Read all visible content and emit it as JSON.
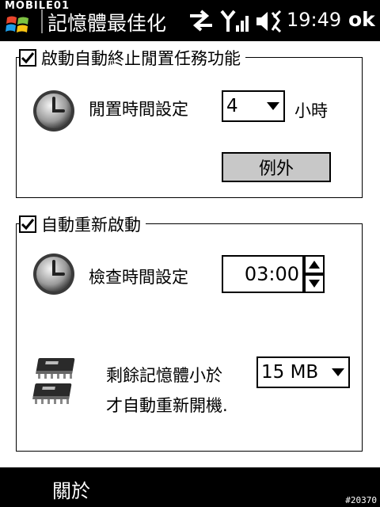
{
  "watermark": "MOBILE01",
  "titlebar": {
    "title": "記憶體最佳化",
    "time": "19:49",
    "ok_label": "ok"
  },
  "group_idle": {
    "checkbox_label": "啟動自動終止閒置任務功能",
    "checked": true,
    "idle_time_label": "閒置時間設定",
    "idle_time_value": "4",
    "idle_time_unit": "小時",
    "exceptions_button": "例外"
  },
  "group_restart": {
    "checkbox_label": "自動重新啟動",
    "checked": true,
    "check_time_label": "檢查時間設定",
    "check_time_value": "03:00",
    "memory_label_line1": "剩餘記憶體小於",
    "memory_label_line2": "才自動重新開機.",
    "memory_threshold": "15 MB"
  },
  "softkeys": {
    "left": "關於"
  },
  "footer_id": "#20370",
  "colors": {
    "bar_background": "#000000",
    "button_gray": "#c8c8c8"
  }
}
